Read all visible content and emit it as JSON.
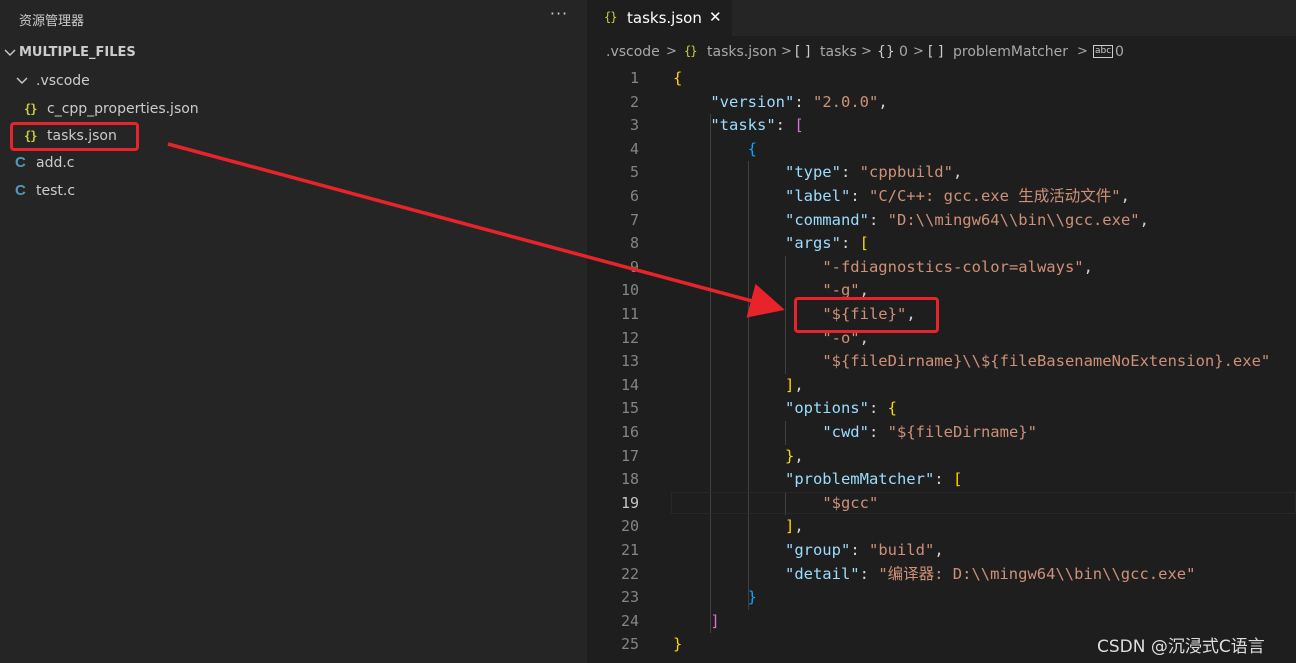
{
  "explorer": {
    "title": "资源管理器",
    "more": "···",
    "root": "MULTIPLE_FILES",
    "items": [
      {
        "label": ".vscode",
        "type": "folder"
      },
      {
        "label": "c_cpp_properties.json",
        "type": "json",
        "icon": "{}"
      },
      {
        "label": "tasks.json",
        "type": "json",
        "icon": "{}"
      },
      {
        "label": "add.c",
        "type": "c",
        "icon": "C"
      },
      {
        "label": "test.c",
        "type": "c",
        "icon": "C"
      }
    ]
  },
  "tab": {
    "icon": "{}",
    "label": "tasks.json",
    "close": "✕"
  },
  "breadcrumb": [
    {
      "icon": "",
      "label": ".vscode"
    },
    {
      "icon": "{}",
      "label": "tasks.json"
    },
    {
      "icon": "[ ]",
      "label": "tasks"
    },
    {
      "icon": "{}",
      "label": "0"
    },
    {
      "icon": "[ ]",
      "label": "problemMatcher"
    },
    {
      "icon": "abc",
      "label": "0"
    }
  ],
  "code": {
    "current_line": 19,
    "lines": [
      [
        [
          "b1",
          "{"
        ]
      ],
      [
        [
          "p",
          "    "
        ],
        [
          "k",
          "\"version\""
        ],
        [
          "p",
          ": "
        ],
        [
          "s",
          "\"2.0.0\""
        ],
        [
          "p",
          ","
        ]
      ],
      [
        [
          "p",
          "    "
        ],
        [
          "k",
          "\"tasks\""
        ],
        [
          "p",
          ": "
        ],
        [
          "b2",
          "["
        ]
      ],
      [
        [
          "p",
          "        "
        ],
        [
          "b3",
          "{"
        ]
      ],
      [
        [
          "p",
          "            "
        ],
        [
          "k",
          "\"type\""
        ],
        [
          "p",
          ": "
        ],
        [
          "s",
          "\"cppbuild\""
        ],
        [
          "p",
          ","
        ]
      ],
      [
        [
          "p",
          "            "
        ],
        [
          "k",
          "\"label\""
        ],
        [
          "p",
          ": "
        ],
        [
          "s",
          "\"C/C++: gcc.exe 生成活动文件\""
        ],
        [
          "p",
          ","
        ]
      ],
      [
        [
          "p",
          "            "
        ],
        [
          "k",
          "\"command\""
        ],
        [
          "p",
          ": "
        ],
        [
          "s",
          "\"D:\\\\mingw64\\\\bin\\\\gcc.exe\""
        ],
        [
          "p",
          ","
        ]
      ],
      [
        [
          "p",
          "            "
        ],
        [
          "k",
          "\"args\""
        ],
        [
          "p",
          ": "
        ],
        [
          "b1",
          "["
        ]
      ],
      [
        [
          "p",
          "                "
        ],
        [
          "s",
          "\"-fdiagnostics-color=always\""
        ],
        [
          "p",
          ","
        ]
      ],
      [
        [
          "p",
          "                "
        ],
        [
          "s",
          "\"-g\""
        ],
        [
          "p",
          ","
        ]
      ],
      [
        [
          "p",
          "                "
        ],
        [
          "s",
          "\"${file}\""
        ],
        [
          "p",
          ","
        ]
      ],
      [
        [
          "p",
          "                "
        ],
        [
          "s",
          "\"-o\""
        ],
        [
          "p",
          ","
        ]
      ],
      [
        [
          "p",
          "                "
        ],
        [
          "s",
          "\"${fileDirname}\\\\${fileBasenameNoExtension}.exe\""
        ]
      ],
      [
        [
          "p",
          "            "
        ],
        [
          "b1",
          "]"
        ],
        [
          "p",
          ","
        ]
      ],
      [
        [
          "p",
          "            "
        ],
        [
          "k",
          "\"options\""
        ],
        [
          "p",
          ": "
        ],
        [
          "b1",
          "{"
        ]
      ],
      [
        [
          "p",
          "                "
        ],
        [
          "k",
          "\"cwd\""
        ],
        [
          "p",
          ": "
        ],
        [
          "s",
          "\"${fileDirname}\""
        ]
      ],
      [
        [
          "p",
          "            "
        ],
        [
          "b1",
          "}"
        ],
        [
          "p",
          ","
        ]
      ],
      [
        [
          "p",
          "            "
        ],
        [
          "k",
          "\"problemMatcher\""
        ],
        [
          "p",
          ": "
        ],
        [
          "b1",
          "["
        ]
      ],
      [
        [
          "p",
          "                "
        ],
        [
          "s",
          "\"$gcc\""
        ]
      ],
      [
        [
          "p",
          "            "
        ],
        [
          "b1",
          "]"
        ],
        [
          "p",
          ","
        ]
      ],
      [
        [
          "p",
          "            "
        ],
        [
          "k",
          "\"group\""
        ],
        [
          "p",
          ": "
        ],
        [
          "s",
          "\"build\""
        ],
        [
          "p",
          ","
        ]
      ],
      [
        [
          "p",
          "            "
        ],
        [
          "k",
          "\"detail\""
        ],
        [
          "p",
          ": "
        ],
        [
          "s",
          "\"编译器: D:\\\\mingw64\\\\bin\\\\gcc.exe\""
        ]
      ],
      [
        [
          "p",
          "        "
        ],
        [
          "b3",
          "}"
        ]
      ],
      [
        [
          "p",
          "    "
        ],
        [
          "b2",
          "]"
        ]
      ],
      [
        [
          "b1",
          "}"
        ]
      ]
    ]
  },
  "watermark": "CSDN @沉浸式C语言",
  "colors": {
    "annotation": "#e8232a",
    "background": "#1e1e1e",
    "sidebar": "#252526"
  }
}
